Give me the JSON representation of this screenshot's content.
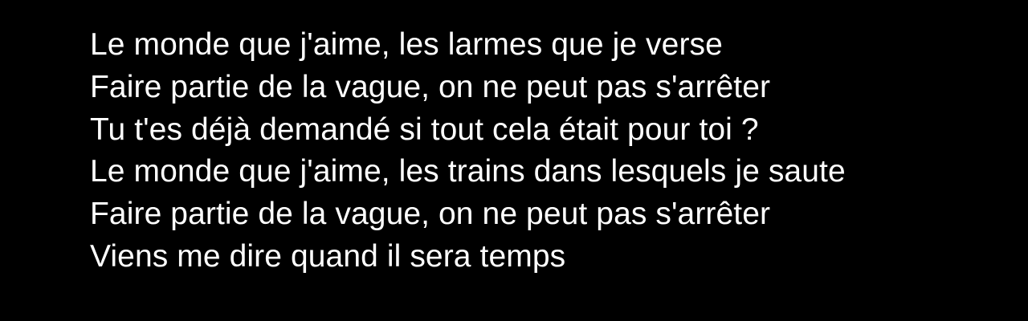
{
  "lyrics": {
    "lines": [
      "Le monde que j'aime, les larmes que je verse",
      "Faire partie de la vague, on ne peut pas s'arrêter",
      "Tu t'es déjà demandé si tout cela était pour toi ?",
      "Le monde que j'aime, les trains dans lesquels je saute",
      "Faire partie de la vague, on ne peut pas s'arrêter",
      "Viens me dire quand il sera temps"
    ]
  },
  "colors": {
    "background": "#000000",
    "text": "#ffffff"
  }
}
